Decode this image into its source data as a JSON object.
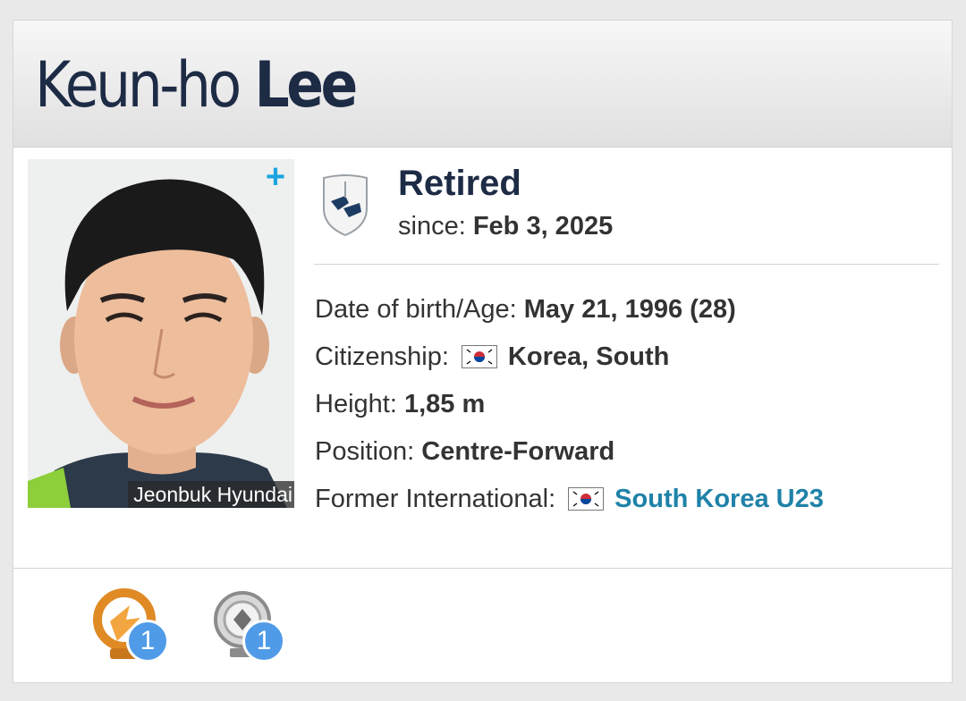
{
  "player": {
    "first_name": "Keun-ho",
    "last_name": "Lee",
    "club_caption": "Jeonbuk Hyundai"
  },
  "status": {
    "title": "Retired",
    "since_label": "since:",
    "since_value": "Feb 3, 2025",
    "icon": "retired-boots-icon"
  },
  "info": {
    "dob_label": "Date of birth/Age:",
    "dob_value": "May 21, 1996 (28)",
    "citizenship_label": "Citizenship:",
    "citizenship_value": "Korea, South",
    "height_label": "Height:",
    "height_value": "1,85 m",
    "position_label": "Position:",
    "position_value": "Centre-Forward",
    "international_label": "Former International:",
    "international_value": "South Korea U23",
    "flag_icon": "south-korea-flag-icon"
  },
  "trophies": [
    {
      "icon": "orange-trophy-icon",
      "count": "1"
    },
    {
      "icon": "silver-trophy-icon",
      "count": "1"
    }
  ],
  "colors": {
    "name": "#1d2b45",
    "link": "#1f82a8",
    "plus": "#1aa5e0",
    "badge": "#4f9be8"
  }
}
